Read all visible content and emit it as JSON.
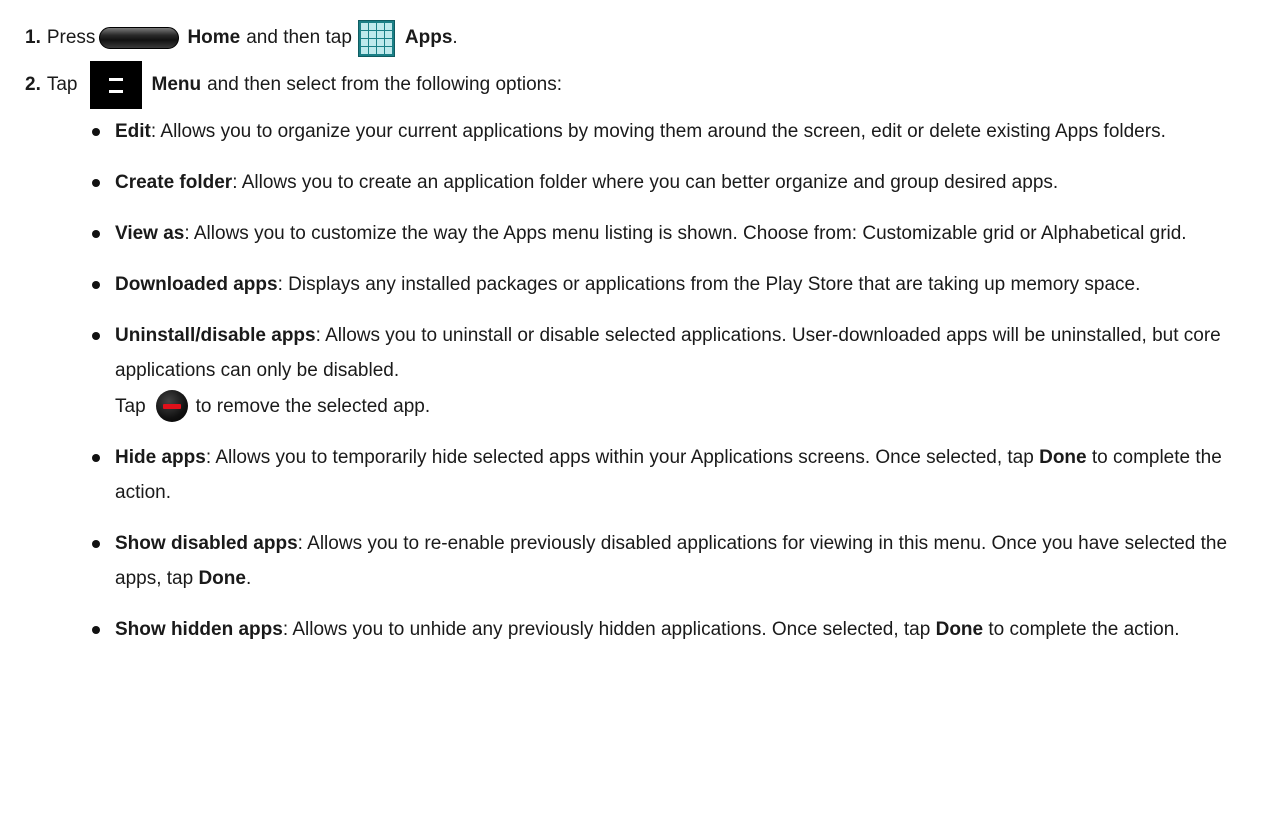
{
  "steps": [
    {
      "num": "1.",
      "t1": "Press",
      "b1": "Home",
      "t2": "and then tap",
      "b2": "Apps",
      "t3": "."
    },
    {
      "num": "2.",
      "t1": "Tap",
      "b1": "Menu",
      "t2": "and then select from the following options:"
    }
  ],
  "icons": {
    "home": "home-button-icon",
    "apps": "apps-grid-icon",
    "menu": "menu-icon",
    "remove": "remove-icon"
  },
  "options": [
    {
      "title": "Edit",
      "desc": ": Allows you to organize your current applications by moving them around the screen, edit or delete existing Apps folders."
    },
    {
      "title": "Create folder",
      "desc": ": Allows you to create an application folder where you can better organize and group desired apps."
    },
    {
      "title": "View as",
      "desc": ": Allows you to customize the way the Apps menu listing is shown. Choose from: Customizable grid or Alphabetical grid."
    },
    {
      "title": "Downloaded apps",
      "desc": ": Displays any installed packages or applications from the Play Store that are taking up memory space."
    },
    {
      "title": "Uninstall/disable apps",
      "desc": ": Allows you to uninstall or disable selected applications. User-downloaded apps will be uninstalled, but core applications can only be disabled.",
      "note_pre": "Tap",
      "note_post": "to remove the selected app."
    },
    {
      "title": "Hide apps",
      "desc": ": Allows you to temporarily hide selected apps within your Applications screens. Once selected, tap",
      "bold2": "Done",
      "desc2": "to complete the action."
    },
    {
      "title": "Show disabled apps",
      "desc": ": Allows you to re-enable previously disabled applications for viewing in this menu. Once you have selected the apps, tap",
      "bold2": "Done",
      "desc2": "."
    },
    {
      "title": "Show hidden apps",
      "desc": ": Allows you to unhide any previously hidden applications. Once selected, tap",
      "bold2": "Done",
      "desc2": "to complete the action."
    }
  ]
}
